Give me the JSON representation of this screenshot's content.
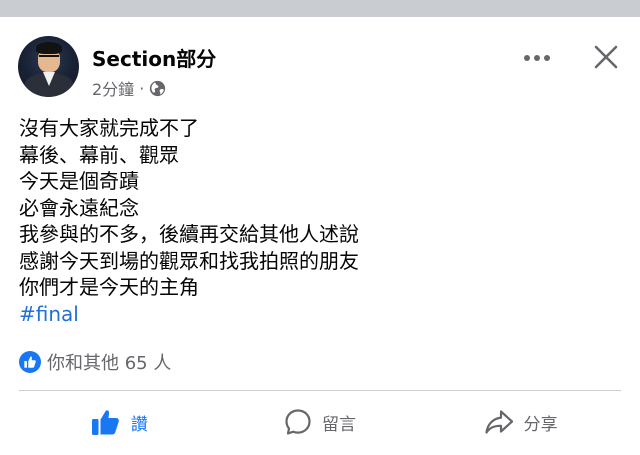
{
  "post": {
    "author": "Section部分",
    "time": "2分鐘",
    "separator": "·",
    "privacy_icon": "globe-icon",
    "lines": [
      "沒有大家就完成不了",
      "幕後、幕前、觀眾",
      "今天是個奇蹟",
      "必會永遠紀念",
      "我參與的不多，後續再交給其他人述說",
      "感謝今天到場的觀眾和找我拍照的朋友",
      "你們才是今天的主角"
    ],
    "hashtag": "#final"
  },
  "header_actions": {
    "more_icon": "more-horizontal-icon",
    "close_icon": "close-icon"
  },
  "reactions": {
    "text": "你和其他 65 人",
    "icon": "like-badge-icon"
  },
  "actions": {
    "like_label": "讚",
    "comment_label": "留言",
    "share_label": "分享"
  },
  "colors": {
    "accent": "#1877f2",
    "hashtag": "#216fdb",
    "secondary_text": "#65676b",
    "divider": "#ced0d4",
    "top_strip": "#c9ccd1"
  }
}
